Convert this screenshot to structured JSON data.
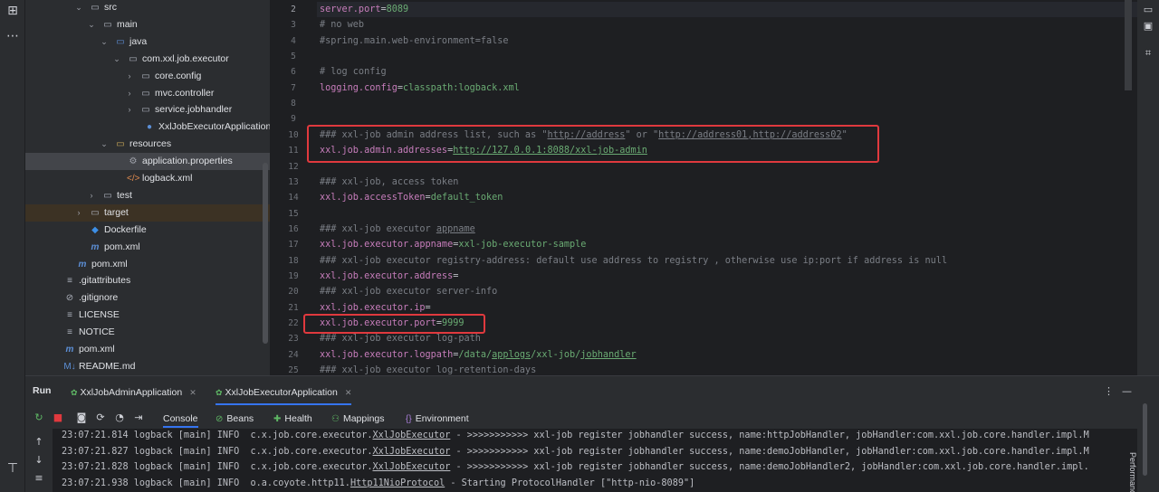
{
  "project_tree": [
    {
      "label": "src",
      "kind": "folder",
      "arrow": "⌄"
    },
    {
      "label": "main",
      "kind": "folder",
      "arrow": "⌄"
    },
    {
      "label": "java",
      "kind": "folder-src",
      "arrow": "⌄"
    },
    {
      "label": "com.xxl.job.executor",
      "kind": "package",
      "arrow": "⌄"
    },
    {
      "label": "core.config",
      "kind": "package",
      "arrow": "›"
    },
    {
      "label": "mvc.controller",
      "kind": "package",
      "arrow": "›"
    },
    {
      "label": "service.jobhandler",
      "kind": "package",
      "arrow": "›"
    },
    {
      "label": "XxlJobExecutorApplication",
      "kind": "class",
      "arrow": ""
    },
    {
      "label": "resources",
      "kind": "folder-res",
      "arrow": "⌄"
    },
    {
      "label": "application.properties",
      "kind": "properties",
      "arrow": ""
    },
    {
      "label": "logback.xml",
      "kind": "xml",
      "arrow": ""
    },
    {
      "label": "test",
      "kind": "folder",
      "arrow": "›"
    },
    {
      "label": "target",
      "kind": "folder",
      "arrow": "›"
    },
    {
      "label": "Dockerfile",
      "kind": "docker",
      "arrow": ""
    },
    {
      "label": "pom.xml",
      "kind": "maven",
      "arrow": ""
    },
    {
      "label": "pom.xml",
      "kind": "maven",
      "arrow": ""
    },
    {
      "label": ".gitattributes",
      "kind": "text",
      "arrow": ""
    },
    {
      "label": ".gitignore",
      "kind": "ignore",
      "arrow": ""
    },
    {
      "label": "LICENSE",
      "kind": "text",
      "arrow": ""
    },
    {
      "label": "NOTICE",
      "kind": "text",
      "arrow": ""
    },
    {
      "label": "pom.xml",
      "kind": "maven",
      "arrow": ""
    },
    {
      "label": "README.md",
      "kind": "markdown",
      "arrow": ""
    }
  ],
  "editor": {
    "line_numbers": [
      "2",
      "3",
      "4",
      "5",
      "6",
      "7",
      "8",
      "9",
      "10",
      "11",
      "12",
      "13",
      "14",
      "15",
      "16",
      "17",
      "18",
      "19",
      "20",
      "21",
      "22",
      "23",
      "24",
      "25"
    ],
    "lines": [
      {
        "key": "server.port",
        "eq": "=",
        "val": "8089"
      },
      {
        "comment": "# no web"
      },
      {
        "comment": "#spring.main.web-environment=false"
      },
      {
        "blank": ""
      },
      {
        "comment": "# log config"
      },
      {
        "key": "logging.config",
        "eq": "=",
        "val": "classpath:logback.xml"
      },
      {
        "blank": ""
      },
      {
        "blank": ""
      },
      {
        "comment_parts": [
          "### xxl-job admin address list, such as \"",
          "http://address",
          "\" or \"",
          "http://address01,http://address02",
          "\""
        ]
      },
      {
        "key": "xxl.job.admin.addresses",
        "eq": "=",
        "url": "http://127.0.0.1:8088/xxl-job-admin"
      },
      {
        "blank": ""
      },
      {
        "comment": "### xxl-job, access token"
      },
      {
        "key": "xxl.job.accessToken",
        "eq": "=",
        "val": "default_token"
      },
      {
        "blank": ""
      },
      {
        "comment_parts": [
          "### xxl-job executor ",
          "appname"
        ]
      },
      {
        "key": "xxl.job.executor.appname",
        "eq": "=",
        "val": "xxl-job-executor-sample"
      },
      {
        "comment": "### xxl-job executor registry-address: default use address to registry , otherwise use ip:port if address is null"
      },
      {
        "key": "xxl.job.executor.address",
        "eq": "=",
        "val": ""
      },
      {
        "comment": "### xxl-job executor server-info"
      },
      {
        "key": "xxl.job.executor.ip",
        "eq": "=",
        "val": ""
      },
      {
        "key": "xxl.job.executor.port",
        "eq": "=",
        "val": "9999"
      },
      {
        "comment": "### xxl-job executor log-path"
      },
      {
        "key": "xxl.job.executor.logpath",
        "eq": "=",
        "val_parts": [
          "/data/",
          "applogs",
          "/xxl-job/",
          "jobhandler"
        ]
      },
      {
        "comment": "### xxl-job executor log-retention-days"
      }
    ]
  },
  "run": {
    "title": "Run",
    "tabs": [
      {
        "label": "XxlJobAdminApplication"
      },
      {
        "label": "XxlJobExecutorApplication"
      }
    ],
    "subtabs": [
      {
        "label": "Console",
        "icon": ""
      },
      {
        "label": "Beans",
        "icon": "⊘"
      },
      {
        "label": "Health",
        "icon": "✚"
      },
      {
        "label": "Mappings",
        "icon": "⚇"
      },
      {
        "label": "Environment",
        "icon": "{}"
      }
    ],
    "logs": [
      {
        "pre": "23:07:21.814 logback [main] INFO  c.x.job.core.executor.",
        "u": "XxlJobExecutor",
        "post": " - >>>>>>>>>>> xxl-job register jobhandler success, name:httpJobHandler, jobHandler:com.xxl.job.core.handler.impl.M"
      },
      {
        "pre": "23:07:21.827 logback [main] INFO  c.x.job.core.executor.",
        "u": "XxlJobExecutor",
        "post": " - >>>>>>>>>>> xxl-job register jobhandler success, name:demoJobHandler, jobHandler:com.xxl.job.core.handler.impl.M"
      },
      {
        "pre": "23:07:21.828 logback [main] INFO  c.x.job.core.executor.",
        "u": "XxlJobExecutor",
        "post": " - >>>>>>>>>>> xxl-job register jobhandler success, name:demoJobHandler2, jobHandler:com.xxl.job.core.handler.impl."
      },
      {
        "pre": "23:07:21.938 logback [main] INFO  o.a.coyote.http11.",
        "u": "Http11NioProtocol",
        "post": " - Starting ProtocolHandler [\"http-nio-8089\"]"
      }
    ],
    "perf_label": "Performance"
  }
}
